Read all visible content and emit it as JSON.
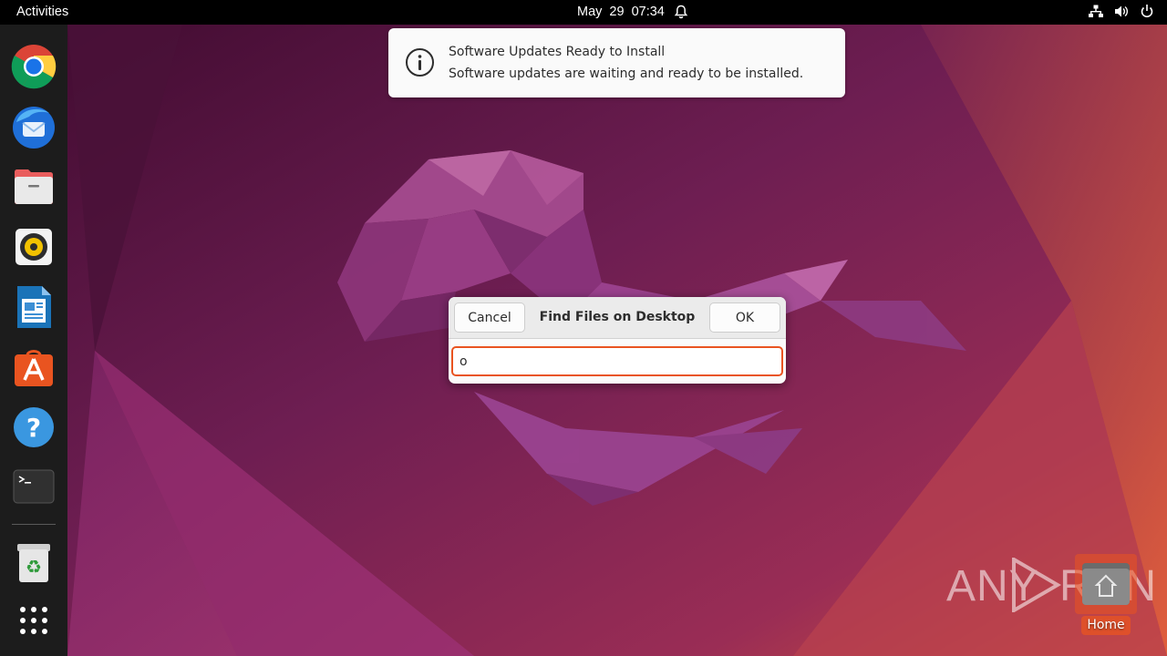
{
  "topbar": {
    "activities_label": "Activities",
    "clock": "May 29  07:34",
    "tray_icons": [
      "network-icon",
      "volume-icon",
      "power-icon"
    ]
  },
  "dock": {
    "items": [
      {
        "name": "chrome-icon"
      },
      {
        "name": "thunderbird-icon"
      },
      {
        "name": "files-icon"
      },
      {
        "name": "rhythmbox-icon"
      },
      {
        "name": "libreoffice-writer-icon"
      },
      {
        "name": "ubuntu-software-icon"
      },
      {
        "name": "help-icon"
      },
      {
        "name": "terminal-icon"
      },
      {
        "name": "trash-icon"
      },
      {
        "name": "show-apps-icon"
      }
    ]
  },
  "notification": {
    "title": "Software Updates Ready to Install",
    "body": "Software updates are waiting and ready to be installed."
  },
  "dialog": {
    "title": "Find Files on Desktop",
    "cancel_label": "Cancel",
    "ok_label": "OK",
    "search_value": "o"
  },
  "watermark": {
    "left_text": "ANY",
    "right_text": "RUN"
  },
  "desktop": {
    "home_label": "Home"
  },
  "colors": {
    "accent": "#e95420",
    "topbar": "#000000",
    "dock": "#1c1c1c",
    "background": "#6b1d4f"
  }
}
